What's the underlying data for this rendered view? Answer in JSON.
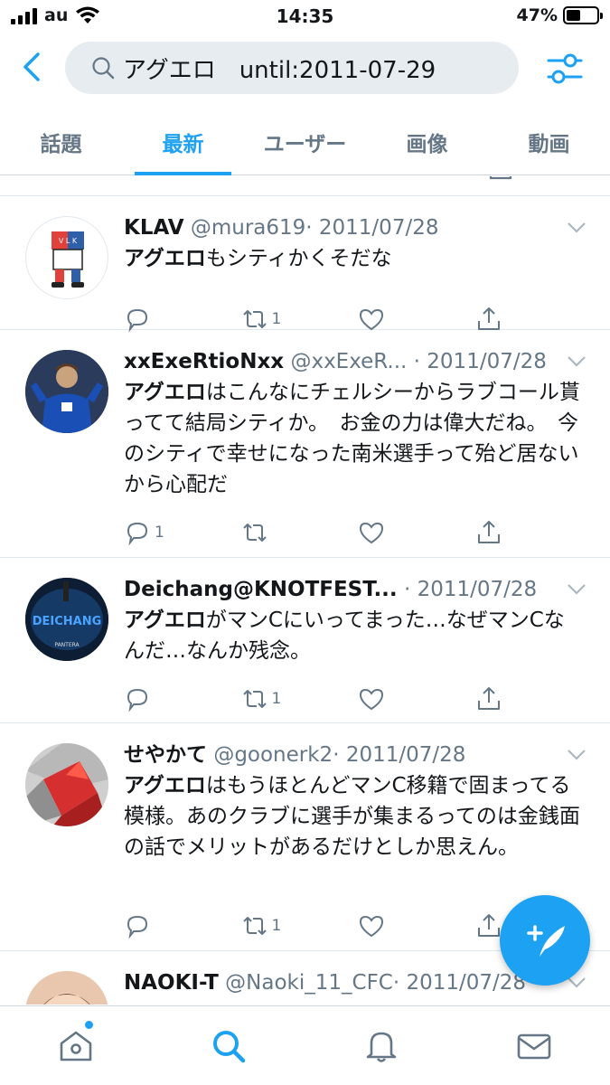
{
  "status_bar": {
    "carrier": "au",
    "time": "14:35",
    "battery": "47%",
    "battery_level": 0.47
  },
  "search": {
    "query": "アグエロ　until:2011-07-29"
  },
  "tabs": [
    {
      "label": "話題"
    },
    {
      "label": "最新"
    },
    {
      "label": "ユーザー"
    },
    {
      "label": "画像"
    },
    {
      "label": "動画"
    }
  ],
  "tweets": [
    {
      "name": "KLAV",
      "handle": "@mura619",
      "date": "· 2011/07/28",
      "keyword": "アグエロ",
      "text": "もシティかくそだな",
      "reply_count": "",
      "retweet_count": "1"
    },
    {
      "name": "xxExeRtioNxx",
      "handle": "@xxExeR...",
      "date": "· 2011/07/28",
      "keyword": "アグエロ",
      "text": "はこんなにチェルシーからラブコール貰ってて結局シティか。　お金の力は偉大だね。　今のシティで幸せになった南米選手って殆ど居ないから心配だ",
      "reply_count": "1",
      "retweet_count": ""
    },
    {
      "name": "Deichang@KNOTFEST...",
      "handle": "",
      "date": "· 2011/07/28",
      "keyword": "アグエロ",
      "text": "がマンCにいってまった…なぜマンCなんだ…なんか残念。",
      "reply_count": "",
      "retweet_count": "1"
    },
    {
      "name": "せやかて",
      "handle": "@goonerk2",
      "date": "· 2011/07/28",
      "keyword": "アグエロ",
      "text": "はもうほとんどマンC移籍で固まってる模様。あのクラブに選手が集まるってのは金銭面の話でメリットがあるだけとしか思えん。",
      "reply_count": "",
      "retweet_count": "1"
    },
    {
      "name": "NAOKI-T",
      "handle": "@Naoki_11_CFC",
      "date": "· 2011/07/28"
    }
  ],
  "avatar_texts": {
    "klav": "V L K",
    "deichang": "DEICHANG",
    "deichang_sub": "PANTERA"
  },
  "colors": {
    "accent": "#1da1f2",
    "muted": "#657786",
    "text": "#14171a",
    "search_bg": "#e6ecf0"
  },
  "icons": [
    "back-icon",
    "search-icon",
    "filter-icon",
    "reply-icon",
    "retweet-icon",
    "like-icon",
    "share-icon",
    "compose-icon",
    "home-icon",
    "explore-icon",
    "notifications-icon",
    "messages-icon"
  ]
}
